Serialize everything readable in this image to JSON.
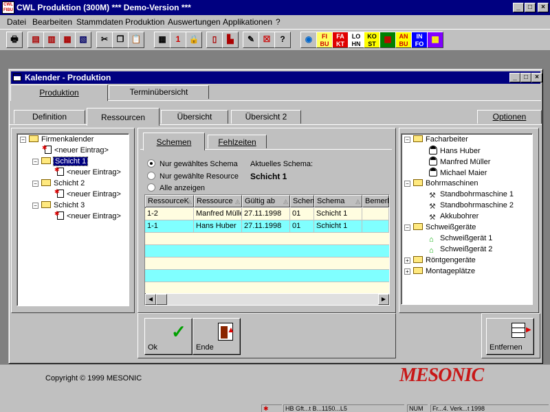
{
  "app": {
    "title": "CWL Produktion (300M) *** Demo-Version ***",
    "icon_text": "CWL\nFIBU"
  },
  "menu": [
    "Datei",
    "Bearbeiten",
    "Stammdaten",
    "Produktion",
    "Auswertungen",
    "Applikationen",
    "?"
  ],
  "toolbar": {
    "labels": {
      "fibu": "FI\nBU",
      "fakt": "FA\nKT",
      "lohn": "LO\nHN",
      "kost": "KO\nST",
      "anbu": "AN\nBU",
      "info": "IN\nFO"
    }
  },
  "window": {
    "title": "Kalender - Produktion",
    "top_tabs": [
      "Produktion",
      "Terminübersicht"
    ],
    "sub_tabs": [
      "Definition",
      "Ressourcen",
      "Übersicht",
      "Übersicht 2"
    ],
    "options_tab": "Optionen"
  },
  "calendar_tree": {
    "root": "Firmenkalender",
    "new_entry": "<neuer Eintrag>",
    "shifts": [
      "Schicht 1",
      "Schicht 2",
      "Schicht 3"
    ],
    "selected": "Schicht 1"
  },
  "schema_tabs": [
    "Schemen",
    "Fehlzeiten"
  ],
  "filter": {
    "options": [
      "Nur gewähltes Schema",
      "Nur gewählte Resource",
      "Alle anzeigen"
    ],
    "selected_index": 0,
    "current_label": "Aktuelles Schema:",
    "current_value": "Schicht 1"
  },
  "table": {
    "columns": [
      "RessourceK",
      "Ressource",
      "Gültig ab",
      "Schen",
      "Schema",
      "Bemerk"
    ],
    "rows": [
      [
        "1-2",
        "Manfred Mülle",
        "27.11.1998",
        "01",
        "Schicht 1",
        ""
      ],
      [
        "1-1",
        "Hans Huber",
        "27.11.1998",
        "01",
        "Schicht 1",
        ""
      ]
    ],
    "empty_rows": 5
  },
  "resource_tree": {
    "groups": [
      {
        "name": "Facharbeiter",
        "expanded": true,
        "items": [
          "Hans Huber",
          "Manfred Müller",
          "Michael Maier"
        ]
      },
      {
        "name": "Bohrmaschinen",
        "expanded": true,
        "items": [
          "Standbohrmaschine 1",
          "Standbohrmaschine 2",
          "Akkubohrer"
        ]
      },
      {
        "name": "Schweißgeräte",
        "expanded": true,
        "items": [
          "Schweißgerät 1",
          "Schweißgerät 2"
        ]
      },
      {
        "name": "Röntgengeräte",
        "expanded": false,
        "items": []
      },
      {
        "name": "Montageplätze",
        "expanded": false,
        "items": []
      }
    ]
  },
  "buttons": {
    "ok": "Ok",
    "end": "Ende",
    "remove": "Entfernen"
  },
  "footer": {
    "copyright": "Copyright © 1999 MESONIC",
    "brand": "MESONIC"
  },
  "statusbar": [
    "HB Gft...t B...1150...L5",
    "NUM",
    "Fr...4. Verk...t 1998"
  ],
  "colors": {
    "title_bg": "#000080",
    "row_highlight": "#80ffff",
    "row_alt": "#fffde0",
    "brand_red": "#c81818"
  }
}
